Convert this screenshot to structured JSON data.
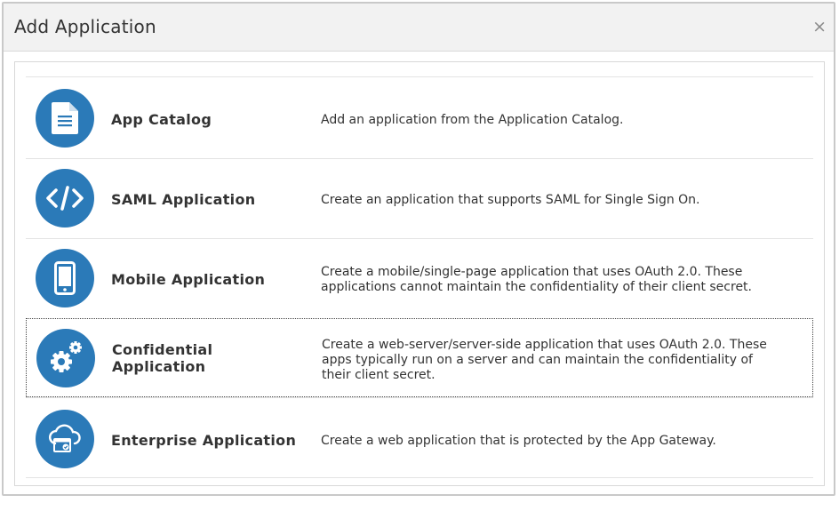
{
  "dialog": {
    "title": "Add Application",
    "close_label": "×"
  },
  "options": [
    {
      "title": "App Catalog",
      "icon": "document-icon",
      "description": "Add an application from the Application Catalog."
    },
    {
      "title": "SAML Application",
      "icon": "code-icon",
      "description": "Create an application that supports SAML for Single Sign On."
    },
    {
      "title": "Mobile Application",
      "icon": "mobile-icon",
      "description": "Create a mobile/single-page application that uses OAuth 2.0. These applications cannot maintain the confidentiality of their client secret."
    },
    {
      "title": "Confidential Application",
      "icon": "gears-icon",
      "description": "Create a web-server/server-side application that uses OAuth 2.0. These apps typically run on a server and can maintain the confidentiality of their client secret."
    },
    {
      "title": "Enterprise Application",
      "icon": "cloud-app-icon",
      "description": "Create a web application that is protected by the App Gateway."
    }
  ],
  "colors": {
    "accent": "#2b7ab8",
    "header_bg": "#f2f2f2"
  }
}
